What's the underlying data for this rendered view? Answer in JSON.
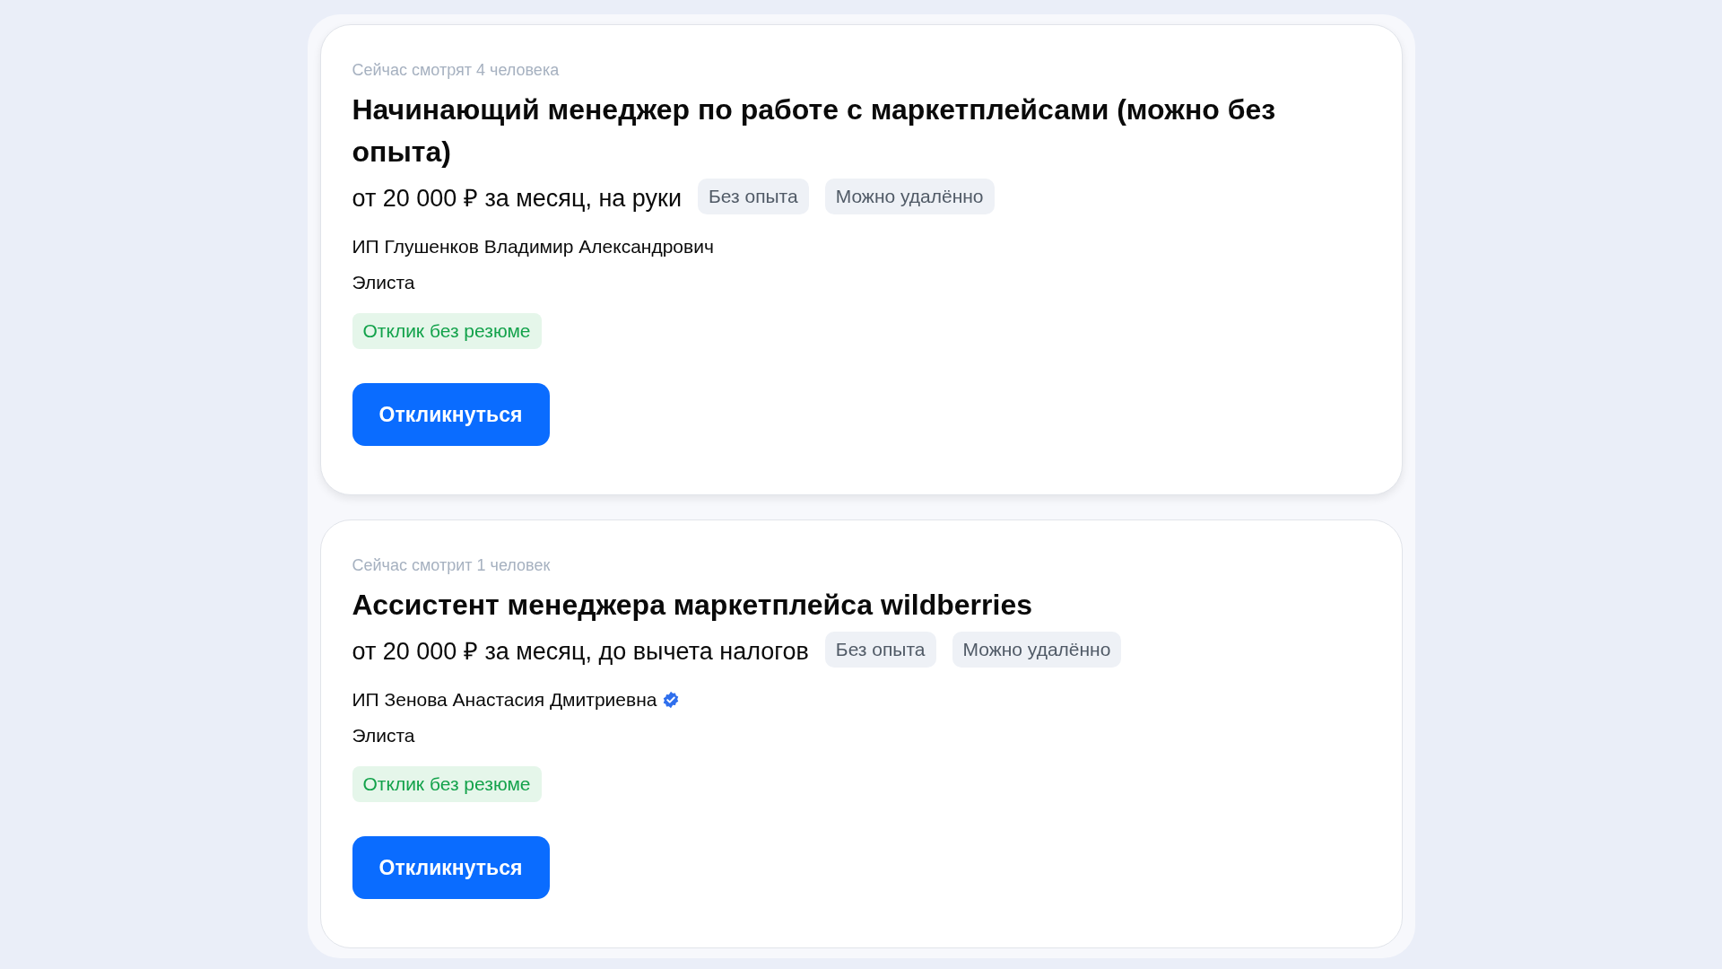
{
  "vacancies": [
    {
      "viewers": "Сейчас смотрят 4 человека",
      "title": "Начинающий менеджер по работе с маркетплейсами (можно без опыта)",
      "salary": "от 20 000 ₽ за месяц, на руки",
      "tags": [
        "Без опыта",
        "Можно удалённо"
      ],
      "company": "ИП Глушенков Владимир Александрович",
      "verified": false,
      "city": "Элиста",
      "badge": "Отклик без резюме",
      "button": "Откликнуться"
    },
    {
      "viewers": "Сейчас смотрит 1 человек",
      "title": "Ассистент менеджера маркетплейса wildberries",
      "salary": "от 20 000 ₽ за месяц, до вычета налогов",
      "tags": [
        "Без опыта",
        "Можно удалённо"
      ],
      "company": "ИП Зенова Анастасия Дмитриевна",
      "verified": true,
      "city": "Элиста",
      "badge": "Отклик без резюме",
      "button": "Откликнуться"
    }
  ]
}
